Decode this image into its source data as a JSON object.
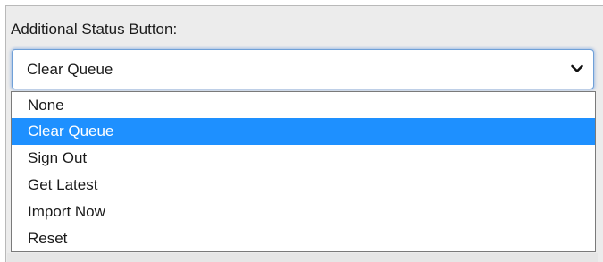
{
  "field": {
    "label": "Additional Status Button:",
    "selected_value": "Clear Queue",
    "expand_icon": "chevron-down-icon"
  },
  "dropdown": {
    "options": [
      {
        "label": "None",
        "selected": false
      },
      {
        "label": "Clear Queue",
        "selected": true
      },
      {
        "label": "Sign Out",
        "selected": false
      },
      {
        "label": "Get Latest",
        "selected": false
      },
      {
        "label": "Import Now",
        "selected": false
      },
      {
        "label": "Reset",
        "selected": false
      }
    ]
  },
  "colors": {
    "highlight": "#1e90ff",
    "focus_ring": "#6fa0d8",
    "panel": "#ececec"
  }
}
